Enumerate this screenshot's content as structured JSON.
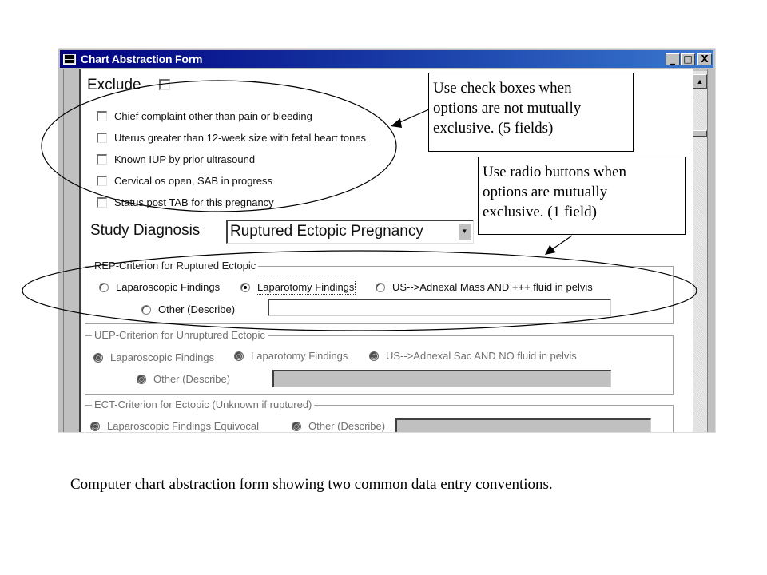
{
  "window": {
    "title": "Chart Abstraction Form",
    "controls": {
      "minimize": "_",
      "maximize": "□",
      "close": "X"
    }
  },
  "form": {
    "exclude": {
      "label": "Exclude",
      "checked": false
    },
    "exclude_criteria": [
      {
        "label": "Chief complaint other than pain or bleeding",
        "checked": false
      },
      {
        "label": "Uterus greater than 12-week size with fetal heart tones",
        "checked": false
      },
      {
        "label": "Known IUP by prior ultrasound",
        "checked": false
      },
      {
        "label": "Cervical os open, SAB in progress",
        "checked": false
      },
      {
        "label": "Status post TAB for this pregnancy",
        "checked": false
      }
    ],
    "study_diagnosis": {
      "label": "Study Diagnosis",
      "value": "Ruptured Ectopic Pregnancy"
    },
    "groups": {
      "rep": {
        "title": "REP-Criterion for Ruptured Ectopic",
        "enabled": true,
        "options": [
          {
            "label": "Laparoscopic Findings",
            "selected": false
          },
          {
            "label": "Laparotomy Findings",
            "selected": true
          },
          {
            "label": "US-->Adnexal Mass AND +++ fluid in pelvis",
            "selected": false
          },
          {
            "label": "Other (Describe)",
            "selected": false
          }
        ],
        "other_text": ""
      },
      "uep": {
        "title": "UEP-Criterion for Unruptured Ectopic",
        "enabled": false,
        "options": [
          {
            "label": "Laparoscopic Findings"
          },
          {
            "label": "Laparotomy Findings"
          },
          {
            "label": "US-->Adnexal Sac AND NO fluid in pelvis"
          },
          {
            "label": "Other (Describe)"
          }
        ],
        "other_text": ""
      },
      "ect": {
        "title": "ECT-Criterion for Ectopic (Unknown if ruptured)",
        "enabled": false,
        "options": [
          {
            "label": "Laparoscopic Findings Equivocal"
          },
          {
            "label": "Other (Describe)"
          }
        ],
        "other_text": ""
      }
    }
  },
  "annotations": {
    "checkbox_callout": "Use check boxes when\noptions are not mutually\nexclusive. (5 fields)",
    "radio_callout": "Use radio buttons when\noptions are mutually\nexclusive. (1 field)"
  },
  "caption": "Computer chart abstraction form showing two common data entry conventions."
}
